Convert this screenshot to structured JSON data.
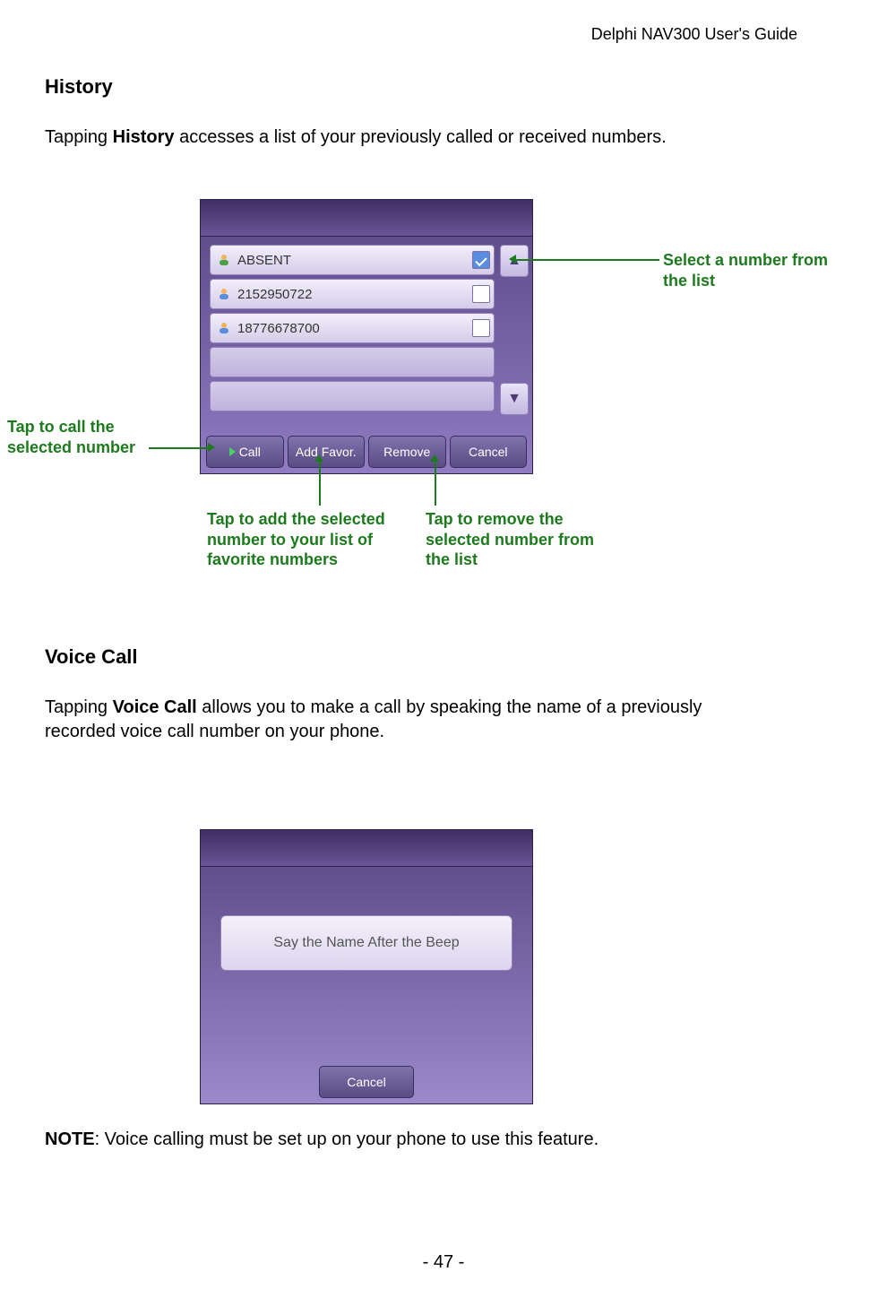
{
  "doc_header": "Delphi NAV300 User's Guide",
  "page_no": "- 47 -",
  "section1": {
    "title": "History",
    "intro_pre": "Tapping ",
    "intro_bold": "History",
    "intro_post": " accesses a list of your previously called or received numbers."
  },
  "history_shot": {
    "rows": [
      {
        "label": "ABSENT",
        "selected": true
      },
      {
        "label": "2152950722",
        "selected": false
      },
      {
        "label": "18776678700",
        "selected": false
      }
    ],
    "buttons": {
      "call": "Call",
      "add": "Add Favor.",
      "remove": "Remove",
      "cancel": "Cancel"
    }
  },
  "callouts": {
    "call": "Tap to call the selected number",
    "add": "Tap to add the selected number to your list of favorite numbers",
    "remove": "Tap to remove the selected number from the list",
    "select": "Select a number from the list"
  },
  "section2": {
    "title": "Voice Call",
    "intro_pre": "Tapping ",
    "intro_bold": "Voice Call",
    "intro_post": " allows you to make a call by speaking the name of a previously recorded voice call number on your phone."
  },
  "voice_shot": {
    "message": "Say the Name After the Beep",
    "cancel": "Cancel"
  },
  "note": {
    "label": "NOTE",
    "text": ": Voice calling must be set up on your phone to use this feature."
  }
}
